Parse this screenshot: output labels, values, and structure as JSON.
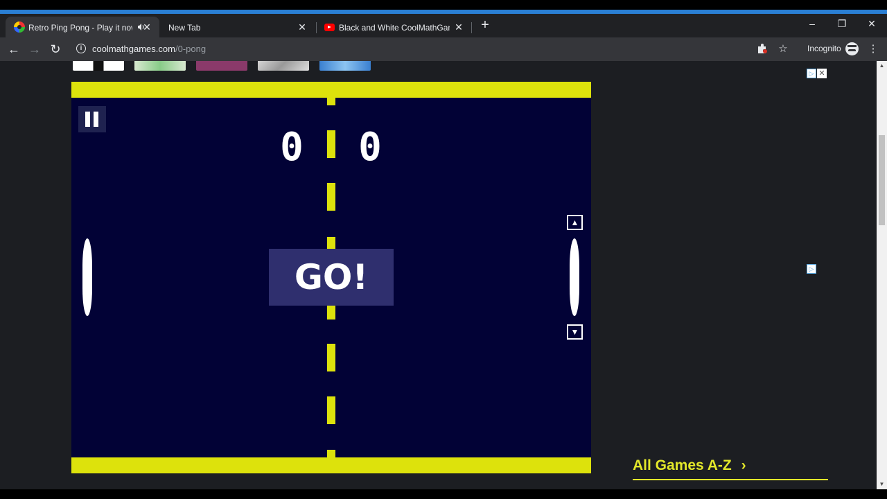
{
  "browser": {
    "tabs": [
      {
        "title": "Retro Ping Pong - Play it now",
        "favicon": "coolmath-favicon",
        "audio": true,
        "active": true
      },
      {
        "title": "New Tab",
        "favicon": "none",
        "active": false
      },
      {
        "title": "Black and White CoolMathGame",
        "favicon": "youtube-favicon",
        "active": false
      }
    ],
    "new_tab_icon": "+",
    "window_controls": {
      "minimize": "–",
      "restore": "❐",
      "close": "✕"
    },
    "url_domain": "coolmathgames.com",
    "url_path": "/0-pong",
    "profile_label": "Incognito"
  },
  "game": {
    "score_left": "0",
    "score_right": "0",
    "go_label": "GO!",
    "up_arrow": "▲",
    "down_arrow": "▼",
    "colors": {
      "field": "#020236",
      "walls": "#dde20c",
      "go_box": "#2f2f6e"
    }
  },
  "sidebar": {
    "all_games_label": "All Games A-Z",
    "all_games_chevron": "›"
  },
  "colors": {
    "accent": "#e3e82a",
    "tab_strip": "#202124",
    "toolbar": "#35363a",
    "page_bg": "#1c1e22"
  }
}
